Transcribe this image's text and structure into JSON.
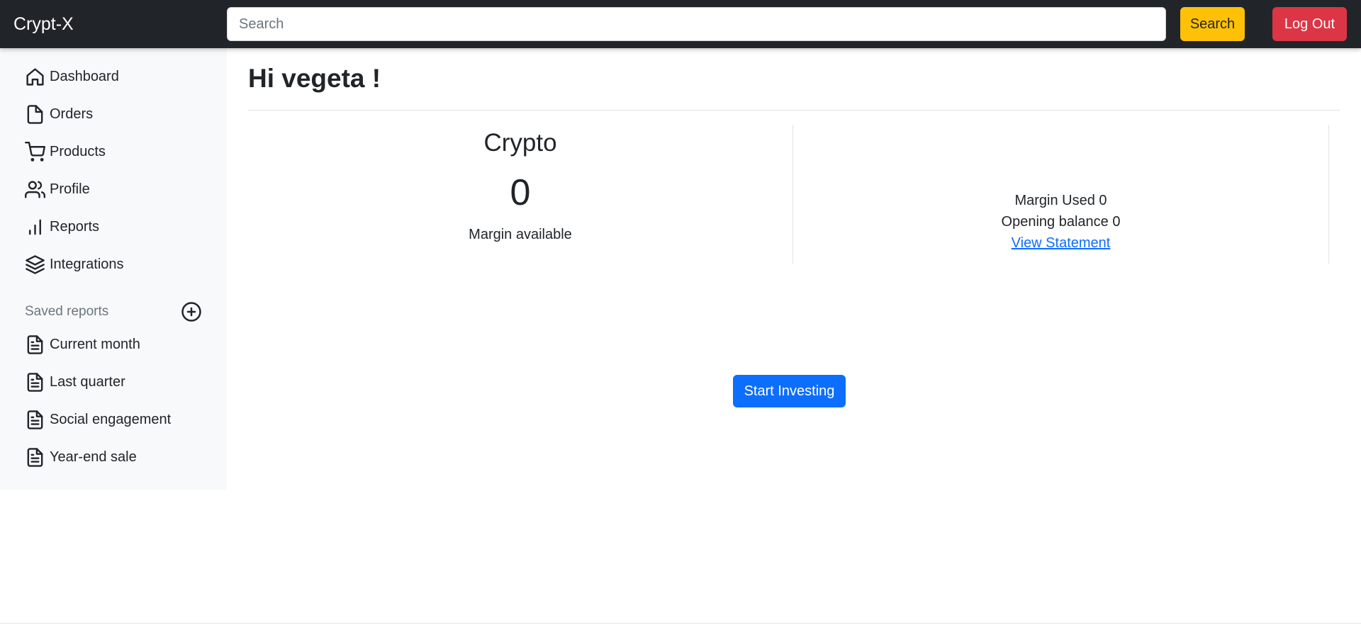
{
  "navbar": {
    "brand": "Crypt-X",
    "search_placeholder": "Search",
    "search_button": "Search",
    "logout_button": "Log Out"
  },
  "sidebar": {
    "items": [
      {
        "label": "Dashboard",
        "icon": "home-icon"
      },
      {
        "label": "Orders",
        "icon": "file-icon"
      },
      {
        "label": "Products",
        "icon": "shopping-cart-icon"
      },
      {
        "label": "Profile",
        "icon": "users-icon"
      },
      {
        "label": "Reports",
        "icon": "bar-chart-icon"
      },
      {
        "label": "Integrations",
        "icon": "layers-icon"
      }
    ],
    "saved_reports_heading": "Saved reports",
    "saved_reports": [
      {
        "label": "Current month",
        "icon": "file-text-icon"
      },
      {
        "label": "Last quarter",
        "icon": "file-text-icon"
      },
      {
        "label": "Social engagement",
        "icon": "file-text-icon"
      },
      {
        "label": "Year-end sale",
        "icon": "file-text-icon"
      }
    ]
  },
  "main": {
    "greeting": "Hi vegeta !",
    "crypto": {
      "title": "Crypto",
      "value": "0",
      "caption": "Margin available"
    },
    "summary": {
      "margin_used": "Margin Used 0",
      "opening_balance": "Opening balance 0",
      "view_statement": "View Statement"
    },
    "start_button": "Start Investing"
  },
  "colors": {
    "navbar_bg": "#212529",
    "sidebar_bg": "#f8f9fa",
    "search_button": "#ffc107",
    "logout_button": "#dc3545",
    "primary": "#0d6efd"
  }
}
